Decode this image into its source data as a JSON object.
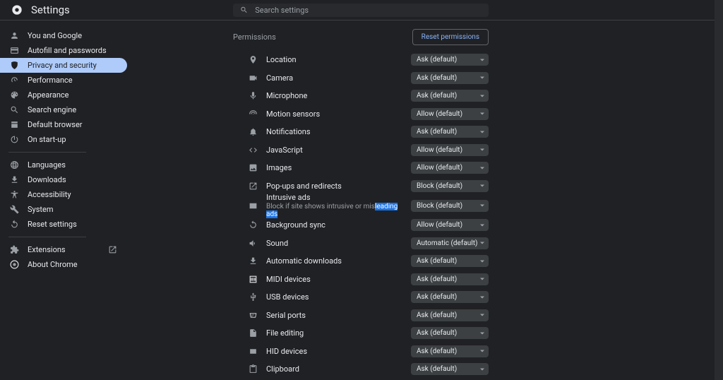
{
  "header": {
    "title": "Settings",
    "search_placeholder": "Search settings"
  },
  "sidebar": {
    "groups": [
      {
        "items": [
          {
            "icon": "person",
            "label": "You and Google"
          },
          {
            "icon": "autofill",
            "label": "Autofill and passwords"
          },
          {
            "icon": "security",
            "label": "Privacy and security",
            "active": true
          },
          {
            "icon": "performance",
            "label": "Performance"
          },
          {
            "icon": "appearance",
            "label": "Appearance"
          },
          {
            "icon": "search",
            "label": "Search engine"
          },
          {
            "icon": "default-browser",
            "label": "Default browser"
          },
          {
            "icon": "startup",
            "label": "On start-up"
          }
        ]
      },
      {
        "items": [
          {
            "icon": "languages",
            "label": "Languages"
          },
          {
            "icon": "downloads",
            "label": "Downloads"
          },
          {
            "icon": "accessibility",
            "label": "Accessibility"
          },
          {
            "icon": "system",
            "label": "System"
          },
          {
            "icon": "reset",
            "label": "Reset settings"
          }
        ]
      },
      {
        "items": [
          {
            "icon": "extensions",
            "label": "Extensions",
            "external": true
          },
          {
            "icon": "about",
            "label": "About Chrome"
          }
        ]
      }
    ]
  },
  "permissions": {
    "title": "Permissions",
    "reset_label": "Reset permissions",
    "rows": [
      {
        "icon": "location",
        "label": "Location",
        "value": "Ask (default)"
      },
      {
        "icon": "camera",
        "label": "Camera",
        "value": "Ask (default)"
      },
      {
        "icon": "mic",
        "label": "Microphone",
        "value": "Ask (default)"
      },
      {
        "icon": "motion",
        "label": "Motion sensors",
        "value": "Allow (default)"
      },
      {
        "icon": "bell",
        "label": "Notifications",
        "value": "Ask (default)"
      },
      {
        "icon": "code",
        "label": "JavaScript",
        "value": "Allow (default)"
      },
      {
        "icon": "image",
        "label": "Images",
        "value": "Allow (default)"
      },
      {
        "icon": "popup",
        "label": "Pop-ups and redirects",
        "value": "Block (default)"
      },
      {
        "icon": "ads",
        "label": "Intrusive ads",
        "sub_pre": "Block if site shows intrusive or mis",
        "sub_hl": "leading ads",
        "value": "Block (default)"
      },
      {
        "icon": "sync",
        "label": "Background sync",
        "value": "Allow (default)"
      },
      {
        "icon": "sound",
        "label": "Sound",
        "value": "Automatic (default)"
      },
      {
        "icon": "download",
        "label": "Automatic downloads",
        "value": "Ask (default)"
      },
      {
        "icon": "midi",
        "label": "MIDI devices",
        "value": "Ask (default)"
      },
      {
        "icon": "usb",
        "label": "USB devices",
        "value": "Ask (default)"
      },
      {
        "icon": "serial",
        "label": "Serial ports",
        "value": "Ask (default)"
      },
      {
        "icon": "file",
        "label": "File editing",
        "value": "Ask (default)"
      },
      {
        "icon": "hid",
        "label": "HID devices",
        "value": "Ask (default)"
      },
      {
        "icon": "clipboard",
        "label": "Clipboard",
        "value": "Ask (default)"
      }
    ]
  }
}
